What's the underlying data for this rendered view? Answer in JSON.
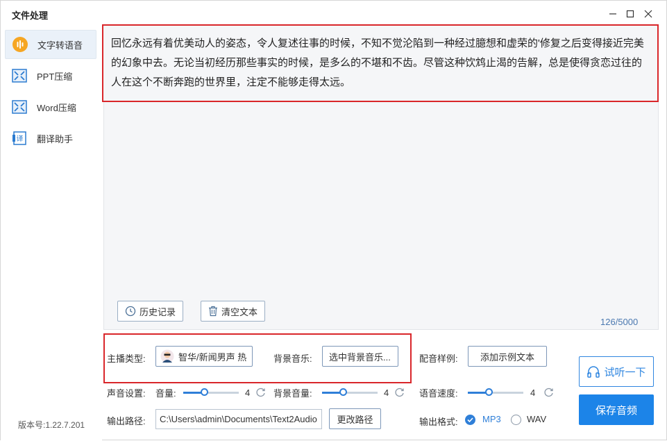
{
  "window": {
    "title": "文件处理"
  },
  "sidebar": {
    "items": [
      {
        "label": "文字转语音",
        "icon": "audio-wave-icon",
        "active": true
      },
      {
        "label": "PPT压缩",
        "icon": "compress-icon"
      },
      {
        "label": "Word压缩",
        "icon": "compress-icon"
      },
      {
        "label": "翻译助手",
        "icon": "translate-icon"
      }
    ],
    "version": "版本号:1.22.7.201"
  },
  "editor": {
    "text": "回忆永远有着优美动人的姿态，令人复述往事的时候，不知不觉沦陷到一种经过臆想和虚荣的'修复之后变得接近完美的幻象中去。无论当初经历那些事实的时候，是多么的不堪和不齿。尽管这种饮鸩止渴的告解，总是使得贪恋过往的人在这个不断奔跑的世界里，注定不能够走得太远。",
    "history_label": "历史记录",
    "clear_label": "清空文本",
    "char_count": "126/5000"
  },
  "settings": {
    "anchor_type_label": "主播类型:",
    "anchor_value": "智华/新闻男声 热",
    "bgm_label": "背景音乐:",
    "bgm_button": "选中背景音乐...",
    "sample_label": "配音样例:",
    "sample_button": "添加示例文本",
    "sound_label": "声音设置:",
    "volume_label": "音量:",
    "volume_value": "4",
    "bg_volume_label": "背景音量:",
    "bg_volume_value": "4",
    "speed_label": "语音速度:",
    "speed_value": "4",
    "output_path_label": "输出路径:",
    "output_path": "C:\\Users\\admin\\Documents\\Text2Audio",
    "change_path_button": "更改路径",
    "format_label": "输出格式:",
    "format_mp3": "MP3",
    "format_wav": "WAV",
    "selected_format": "MP3"
  },
  "actions": {
    "listen": "试听一下",
    "save": "保存音频"
  },
  "colors": {
    "accent": "#1c84e8",
    "highlight_box": "#d9262a"
  }
}
